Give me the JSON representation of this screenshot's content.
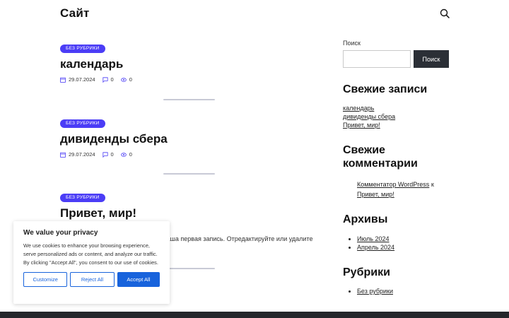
{
  "header": {
    "site_title": "Сайт"
  },
  "posts": [
    {
      "category": "Без рубрики",
      "title": "календарь",
      "date": "29.07.2024",
      "comments": "0",
      "views": "0"
    },
    {
      "category": "Без рубрики",
      "title": "дивиденды сбера",
      "date": "29.07.2024",
      "comments": "0",
      "views": "0"
    },
    {
      "category": "Без рубрики",
      "title": "Привет, мир!",
      "excerpt": "ваша первая запись. Отредактируйте или удалите"
    }
  ],
  "sidebar": {
    "search_label": "Поиск",
    "search_button": "Поиск",
    "search_value": "",
    "recent_posts_title": "Свежие записи",
    "recent_posts": [
      "календарь",
      "дивиденды сбера",
      "Привет, мир!"
    ],
    "recent_comments_title": "Свежие комментарии",
    "comment_author": "Комментатор WordPress",
    "comment_connector": "к",
    "comment_post": "Привет, мир!",
    "archives_title": "Архивы",
    "archives": [
      "Июль 2024",
      "Апрель 2024"
    ],
    "categories_title": "Рубрики",
    "categories": [
      "Без рубрики"
    ]
  },
  "cookie": {
    "title": "We value your privacy",
    "text": "We use cookies to enhance your browsing experience, serve personalized ads or content, and analyze our traffic. By clicking \"Accept All\", you consent to our use of cookies.",
    "customize": "Customize",
    "reject": "Reject All",
    "accept": "Accept All"
  },
  "colors": {
    "badge": "#4b3df6",
    "accent": "#1863dc",
    "dark_button": "#2b2f36",
    "footer": "#24272b"
  }
}
